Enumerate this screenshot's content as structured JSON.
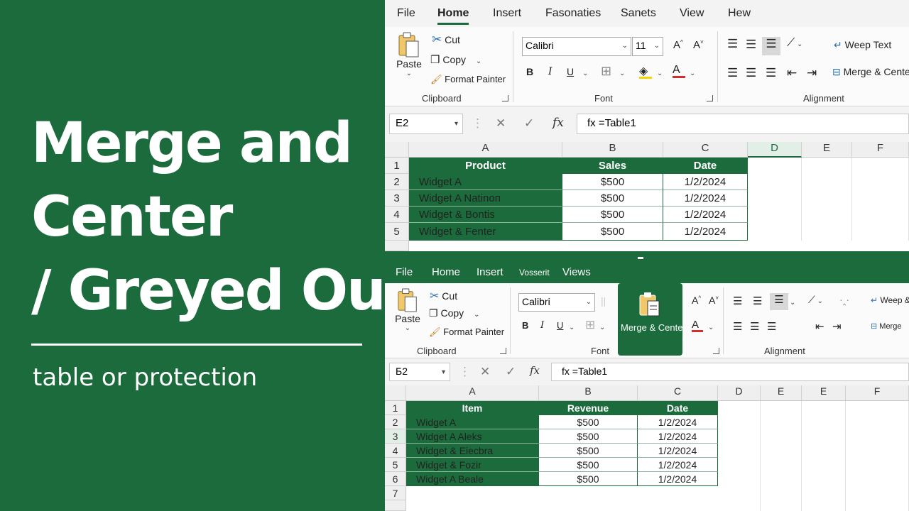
{
  "banner": {
    "title_lines": [
      "Merge and",
      "Center",
      "/ Greyed Out"
    ],
    "subtitle": "table or protection"
  },
  "colors": {
    "accent": "#1b6b3c",
    "font_color_red": "#d32f2f",
    "highlight_yellow": "#f5d400"
  },
  "top": {
    "tabs": [
      "File",
      "Home",
      "Insert",
      "Fasonaties",
      "Sanets",
      "View",
      "Hew"
    ],
    "active_tab": "Home",
    "clipboard": {
      "paste": "Paste",
      "cut": "Cut",
      "copy": "Copy",
      "format_painter": "Format Painter",
      "label": "Clipboard"
    },
    "font": {
      "name": "Calibri",
      "size": "11",
      "bold": "B",
      "italic": "I",
      "underline": "U",
      "label": "Font"
    },
    "alignment": {
      "wrap": "Weep Text",
      "merge": "Merge & Cente",
      "label": "Alignment"
    },
    "formula_bar": {
      "name_box": "E2",
      "cancel": "✕",
      "enter": "✓",
      "fx": "fx",
      "value": "fx =Table1"
    },
    "columns": [
      "A",
      "B",
      "C",
      "D",
      "E",
      "F"
    ],
    "selected_column": "D",
    "row_numbers": [
      "1",
      "2",
      "3",
      "4",
      "5"
    ],
    "table": {
      "headers": [
        "Product",
        "Sales",
        "Date"
      ],
      "rows": [
        [
          "Widget A",
          "$500",
          "1/2/2024"
        ],
        [
          "Widget A Natinoп",
          "$500",
          "1/2/2024"
        ],
        [
          "Widget & Bontis",
          "$500",
          "1/2/2024"
        ],
        [
          "Widget & Fenter",
          "$500",
          "1/2/2024"
        ]
      ]
    }
  },
  "bottom": {
    "tabs": [
      "File",
      "Home",
      "Insert",
      "Vosserit",
      "Views"
    ],
    "clipboard": {
      "paste": "Paste",
      "cut": "Cut",
      "copy": "Copy",
      "format_painter": "Format Painter",
      "label": "Clipboard"
    },
    "font": {
      "name": "Calibri",
      "bold": "B",
      "italic": "I",
      "underline": "U",
      "label": "Font"
    },
    "merge_center": "Merge & Center",
    "alignment": {
      "wrap": "Weep &",
      "merge": "Merge",
      "label": "Alignment"
    },
    "formula_bar": {
      "name_box": "Б2",
      "cancel": "✕",
      "enter": "✓",
      "fx": "fx",
      "value": "fx =Table1"
    },
    "columns": [
      "A",
      "B",
      "C",
      "D",
      "E",
      "E",
      "F"
    ],
    "row_numbers": [
      "1",
      "2",
      "3",
      "4",
      "5",
      "6",
      "7"
    ],
    "table": {
      "headers": [
        "Item",
        "Revenue",
        "Date"
      ],
      "rows": [
        [
          "Widget A",
          "$500",
          "1/2/2024"
        ],
        [
          "Widget A Aleks",
          "$500",
          "1/2/2024"
        ],
        [
          "Widget & Eiecbra",
          "$500",
          "1/2/2024"
        ],
        [
          "Widget & Fozir",
          "$500",
          "1/2/2024"
        ],
        [
          "Widget A Beale",
          "$500",
          "1/2/2024"
        ]
      ]
    }
  }
}
